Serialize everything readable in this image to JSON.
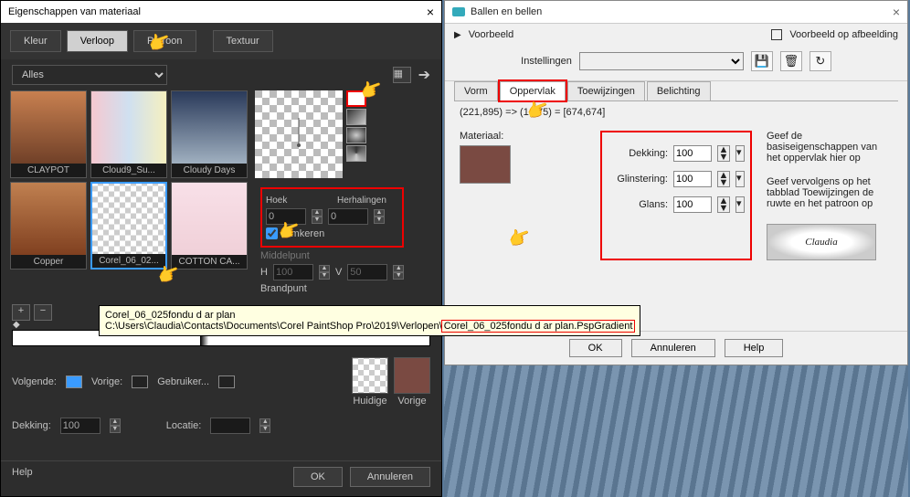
{
  "left": {
    "title": "Eigenschappen van materiaal",
    "tabs": {
      "kleur": "Kleur",
      "verloop": "Verloop",
      "patroon": "Patroon",
      "textuur": "Textuur"
    },
    "filter": "Alles",
    "swatches": [
      {
        "label": "CLAYPOT"
      },
      {
        "label": "Cloud9_Su..."
      },
      {
        "label": "Cloudy Days"
      },
      {
        "label": "Copper"
      },
      {
        "label": "Corel_06_02..."
      },
      {
        "label": "COTTON CA..."
      }
    ],
    "params": {
      "hoek_label": "Hoek",
      "hoek_value": "0",
      "herhalingen_label": "Herhalingen",
      "herhalingen_value": "0",
      "omkeren_label": "Omkeren",
      "middelpunt_label": "Middelpunt",
      "h_label": "H",
      "h_value": "100",
      "v_label": "V",
      "v_value": "50",
      "brandpunt_label": "Brandpunt"
    },
    "volgende_label": "Volgende:",
    "vorige_label": "Vorige:",
    "gebruiken_label": "Gebruiker...",
    "dekking_label": "Dekking:",
    "dekking_value": "100",
    "locatie_label": "Locatie:",
    "huidige_label": "Huidige",
    "vorige_chip_label": "Vorige",
    "help": "Help",
    "ok": "OK",
    "annuleren": "Annuleren"
  },
  "right": {
    "title": "Ballen en bellen",
    "voorbeeld": "Voorbeeld",
    "voorbeeld_op": "Voorbeeld op afbeelding",
    "instellingen": "Instellingen",
    "tabs": {
      "vorm": "Vorm",
      "oppervlak": "Oppervlak",
      "toewijzingen": "Toewijzingen",
      "belichting": "Belichting"
    },
    "coords": "(221,895) => (1,675) = [674,674]",
    "materiaal_label": "Materiaal:",
    "dekking_label": "Dekking:",
    "dekking_value": "100",
    "glinstering_label": "Glinstering:",
    "glinstering_value": "100",
    "glans_label": "Glans:",
    "glans_value": "100",
    "desc1": "Geef de basiseigenschappen van het oppervlak hier op",
    "desc2": "Geef vervolgens op het tabblad Toewijzingen de ruwte en het patroon op",
    "logo": "Claudia",
    "ok": "OK",
    "annuleren": "Annuleren",
    "help": "Help"
  },
  "tooltip": {
    "line1": "Corel_06_025fondu d ar plan",
    "line2a": "C:\\Users\\Claudia\\Contacts\\Documents\\Corel PaintShop Pro\\2019\\Verlopen\\",
    "line2b": "Corel_06_025fondu d ar plan.PspGradient"
  }
}
